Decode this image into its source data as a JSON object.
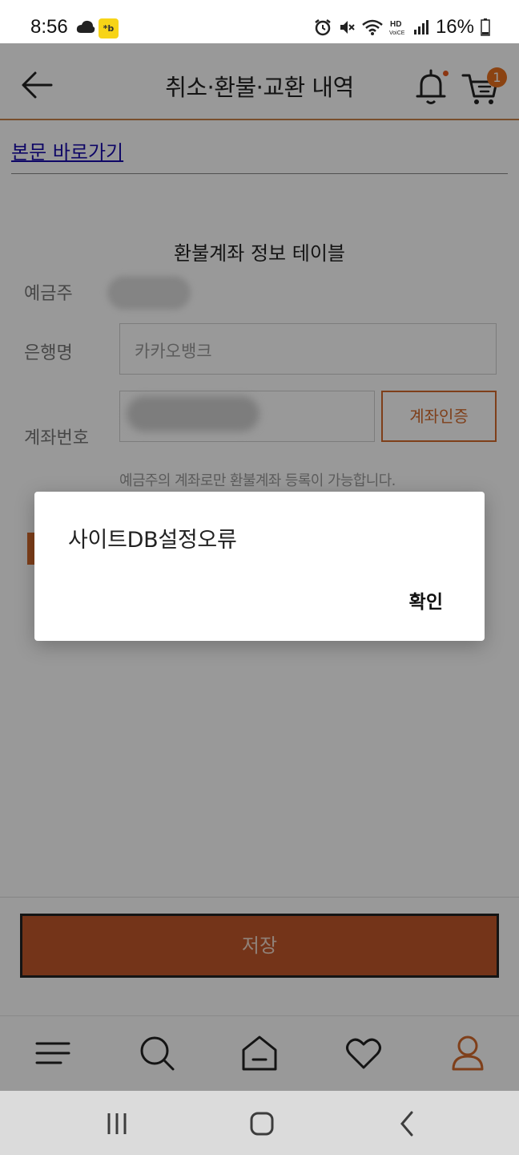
{
  "status_bar": {
    "time": "8:56",
    "kakao_icon_text": "*b",
    "battery_text": "16%",
    "icons": [
      "cloud-icon",
      "kakao-notification-icon",
      "alarm-icon",
      "mute-icon",
      "wifi-icon",
      "hd-voice-icon",
      "signal-icon",
      "battery-icon"
    ]
  },
  "header": {
    "title": "취소·환불·교환 내역",
    "cart_count": "1",
    "accent_color": "#c8834a"
  },
  "content": {
    "skip_link": "본문 바로가기",
    "table_caption": "환불계좌 정보 테이블",
    "fields": {
      "depositor_label": "예금주",
      "bank_label": "은행명",
      "bank_value": "카카오뱅크",
      "account_label": "계좌번호",
      "verify_button": "계좌인증"
    },
    "hint": "예금주의 계좌로만 환불계좌 등록이 가능합니다.",
    "save_button": "저장"
  },
  "bottom_nav": {
    "items": [
      "menu-icon",
      "search-icon",
      "home-icon",
      "heart-icon",
      "user-icon"
    ],
    "active_color": "#d46a2c"
  },
  "dialog": {
    "message": "사이트DB설정오류",
    "ok_button": "확인"
  },
  "colors": {
    "brand": "#d46a2c",
    "save_button_bg": "#c2582a"
  }
}
